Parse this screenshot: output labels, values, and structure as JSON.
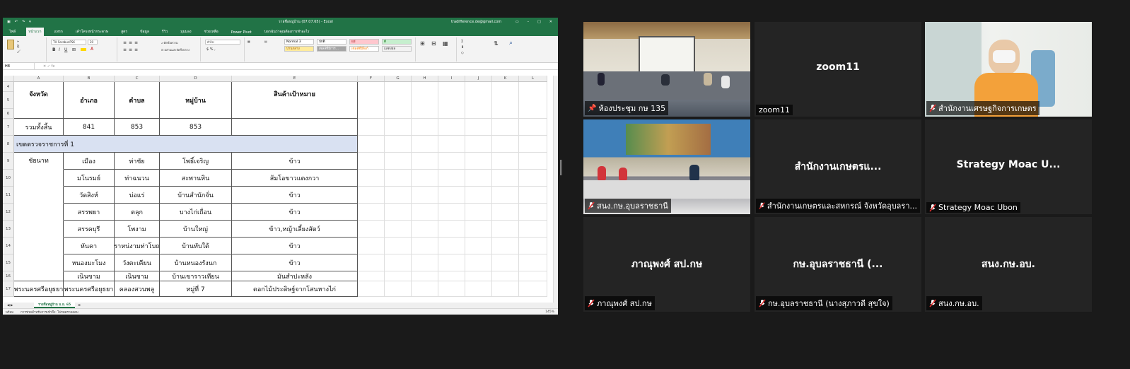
{
  "excel": {
    "title_bar": {
      "doc_title": "รายชื่อหมู่บ้าน (07.07.65) - Excel",
      "account": "tradifference.de@gmail.com"
    },
    "tabs": [
      "ไฟล์",
      "หน้าแรก",
      "แทรก",
      "เค้าโครงหน้ากระดาษ",
      "สูตร",
      "ข้อมูล",
      "รีวิว",
      "มุมมอง",
      "ช่วยเหลือ",
      "Power Pivot",
      "บอกฉันว่าคุณต้องการทำอะไร"
    ],
    "active_tab_index": 1,
    "ribbon": {
      "font_name": "TH SarabunPSK",
      "font_size": "20",
      "number_format": "ทั่วไป",
      "styles": [
        "Normal 3",
        "ปกติ",
        "แย่",
        "ดี",
        "ปานกลาง",
        "เซลล์ที่มีการ...",
        "เซลล์ที่มีลิงก์",
        "แสดงผล"
      ]
    },
    "name_box": "H8",
    "columns": [
      "A",
      "B",
      "C",
      "D",
      "E",
      "F",
      "G",
      "H",
      "I",
      "J",
      "K",
      "L"
    ],
    "header_rows": [
      "4",
      "5",
      "6"
    ],
    "headers": {
      "province": "จังหวัด",
      "district": "อำเภอ",
      "subdistrict": "ตำบล",
      "village": "หมู่บ้าน",
      "product": "สินค้าเป้าหมาย"
    },
    "total": {
      "row": "7",
      "label": "รวมทั้งสิ้น",
      "district": "841",
      "subdistrict": "853",
      "village": "853",
      "product": ""
    },
    "band": {
      "row": "8",
      "label": "เขตตรวจราชการที่ 1"
    },
    "data_rows": [
      {
        "row": "9",
        "province": "ชัยนาท",
        "district": "เมือง",
        "subdistrict": "ท่าชัย",
        "village": "โพธิ์เจริญ",
        "product": "ข้าว"
      },
      {
        "row": "10",
        "province": "",
        "district": "มโนรมย์",
        "subdistrict": "ท่าฉนวน",
        "village": "สะพานหิน",
        "product": "ส้มโอขาวแตงกวา"
      },
      {
        "row": "11",
        "province": "",
        "district": "วัดสิงห์",
        "subdistrict": "บ่อแร่",
        "village": "บ้านสำนักจั่น",
        "product": "ข้าว"
      },
      {
        "row": "12",
        "province": "",
        "district": "สรรพยา",
        "subdistrict": "ตลุก",
        "village": "บางไก่เถื่อน",
        "product": "ข้าว"
      },
      {
        "row": "13",
        "province": "",
        "district": "สรรคบุรี",
        "subdistrict": "โพงาม",
        "village": "บ้านใหญ่",
        "product": "ข้าว,หญ้าเลี้ยงสัตว์"
      },
      {
        "row": "14",
        "province": "",
        "district": "หันคา",
        "subdistrict": "ราหน่งามท่าโบถ",
        "village": "บ้านทับใต้",
        "product": "ข้าว"
      },
      {
        "row": "15",
        "province": "",
        "district": "หนองมะโมง",
        "subdistrict": "วังตะเคียน",
        "village": "บ้านหนองรังนก",
        "product": "ข้าว"
      },
      {
        "row": "16",
        "province": "",
        "district": "เนินขาม",
        "subdistrict": "เนินขาม",
        "village": "บ้านเขาราวเทียน",
        "product": "มันสำปะหลัง"
      },
      {
        "row": "17",
        "province": "พระนครศรีอยุธยา",
        "district": "พระนครศรีอยุธยา",
        "subdistrict": "คลองสวนพลู",
        "village": "หมู่ที่ 7",
        "product": "ดอกไม้ประดิษฐ์จากโสนหางไก่"
      }
    ],
    "sheet_tab": "รายชื่อหมู่บ้าน ม.ย. 65",
    "status_left": "พร้อม",
    "status_text": "การช่วยสำหรับการเข้าถึง: โปรดตรวจสอบ",
    "zoom_level": "145%"
  },
  "zoom": {
    "tiles": [
      {
        "center": "",
        "name": "ห้องประชุม กษ 135",
        "muted": false,
        "active": true,
        "pinned": true
      },
      {
        "center": "zoom11",
        "name": "zoom11",
        "muted": false,
        "active": false
      },
      {
        "center": "",
        "name": "สำนักงานเศรษฐกิจการเกษตร",
        "muted": true,
        "active": false
      },
      {
        "center": "",
        "name": "สนง.กษ.อุบลราชธานี",
        "muted": true,
        "active": false
      },
      {
        "center": "สำนักงานเกษตรแ...",
        "name": "สำนักงานเกษตรและสหกรณ์ จังหวัดอุบลรา...",
        "muted": true,
        "active": false
      },
      {
        "center": "Strategy Moac U...",
        "name": "Strategy Moac Ubon",
        "muted": true,
        "active": false
      },
      {
        "center": "ภาณุพงศ์ สป.กษ",
        "name": "ภาณุพงศ์ สป.กษ",
        "muted": true,
        "active": false
      },
      {
        "center": "กษ.อุบลราชธานี (...",
        "name": "กษ.อุบลราชธานี (นางสุภาวดี สุขใจ)",
        "muted": true,
        "active": false
      },
      {
        "center": "สนง.กษ.อบ.",
        "name": "สนง.กษ.อบ.",
        "muted": true,
        "active": false
      }
    ]
  }
}
